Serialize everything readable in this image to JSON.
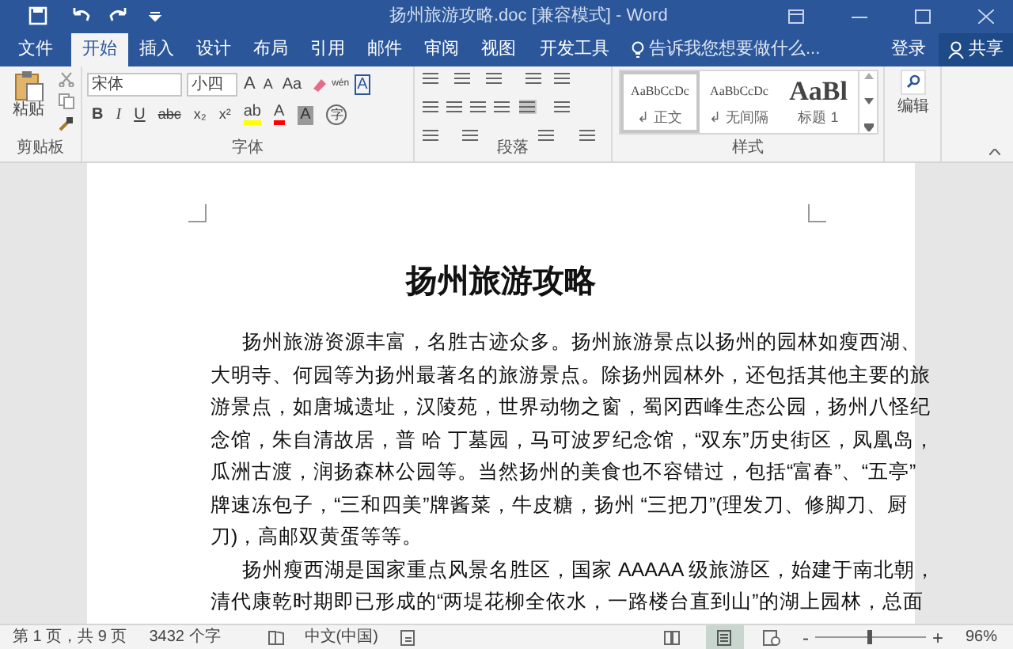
{
  "window": {
    "title": "扬州旅游攻略.doc [兼容模式] - Word"
  },
  "tabs": [
    {
      "label": "文件",
      "selected": false
    },
    {
      "label": "开始",
      "selected": true
    },
    {
      "label": "插入",
      "selected": false
    },
    {
      "label": "设计",
      "selected": false
    },
    {
      "label": "布局",
      "selected": false
    },
    {
      "label": "引用",
      "selected": false
    },
    {
      "label": "邮件",
      "selected": false
    },
    {
      "label": "审阅",
      "selected": false
    },
    {
      "label": "视图",
      "selected": false
    },
    {
      "label": "开发工具",
      "selected": false
    }
  ],
  "tell_me": {
    "placeholder": "告诉我您想要做什么..."
  },
  "account": {
    "sign_in": "登录",
    "share": "共享"
  },
  "ribbon": {
    "clipboard": {
      "paste": "粘贴",
      "label": "剪贴板"
    },
    "font": {
      "font_name": "宋体",
      "font_size": "小四",
      "label": "字体",
      "grow": "A",
      "shrink": "A",
      "case": "Aa",
      "phonetic": "wén",
      "border_char": "A",
      "format_buttons": [
        "B",
        "I",
        "U",
        "abc",
        "x₂",
        "x²"
      ],
      "highlight": "ab",
      "font_color": "A",
      "shading": "A",
      "enclosed": "字"
    },
    "paragraph": {
      "label": "段落"
    },
    "styles": {
      "label": "样式",
      "items": [
        {
          "preview": "AaBbCcDc",
          "name": "↲ 正文",
          "selected": true,
          "kind": "normal"
        },
        {
          "preview": "AaBbCcDc",
          "name": "↲ 无间隔",
          "selected": false,
          "kind": "normal"
        },
        {
          "preview": "AaBl",
          "name": "标题 1",
          "selected": false,
          "kind": "heading"
        }
      ]
    },
    "editing": {
      "label": "编辑"
    }
  },
  "document": {
    "title": "扬州旅游攻略",
    "paragraphs": [
      {
        "lines": [
          "扬州旅游资源丰富，名胜古迹众多。扬州旅游景点以扬州的园林如瘦西湖、",
          "大明寺、何园等为扬州最著名的旅游景点。除扬州园林外，还包括其他主要的旅",
          "游景点，如唐城遗址，汉陵苑，世界动物之窗，蜀冈西峰生态公园，扬州八怪纪",
          "念馆，朱自清故居，普 哈 丁墓园，马可波罗纪念馆，“双东”历史街区，凤凰岛，",
          "瓜洲古渡，润扬森林公园等。当然扬州的美食也不容错过，包括“富春”、“五亭”",
          "牌速冻包子，“三和四美”牌酱菜，牛皮糖，扬州 “三把刀”(理发刀、修脚刀、厨",
          "刀)，高邮双黄蛋等等。"
        ]
      },
      {
        "lines": [
          "扬州瘦西湖是国家重点风景名胜区，国家 AAAAA 级旅游区，始建于南北朝，",
          "清代康乾时期即已形成的“两堤花柳全依水，一路楼台直到山”的湖上园林，总面"
        ]
      }
    ]
  },
  "status_bar": {
    "page": "第 1 页，共 9 页",
    "words": "3432 个字",
    "language": "中文(中国)",
    "zoom_out": "-",
    "zoom_in": "+",
    "zoom": "96%",
    "zoom_slider": {
      "level": 0.5
    }
  }
}
